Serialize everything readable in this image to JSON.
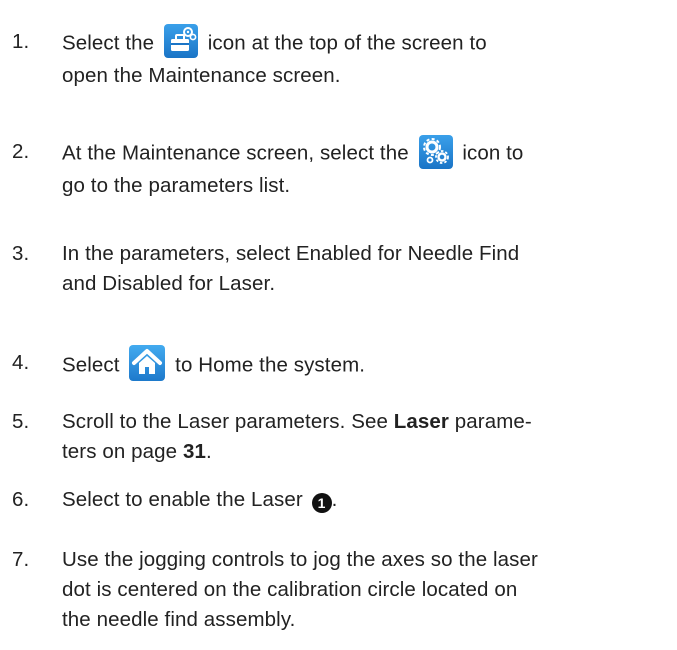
{
  "steps": [
    {
      "num": "1.",
      "text_before": "Select the",
      "icon": "maintenance-toolbox-icon",
      "text_after": "icon at the top of the screen to",
      "line2": "open the Maintenance screen."
    },
    {
      "num": "2.",
      "text_before": "At the Maintenance screen, select the",
      "icon": "gears-icon",
      "text_after": "icon to",
      "line2": "go to the parameters list."
    },
    {
      "num": "3.",
      "line1": "In the parameters, select Enabled for Needle Find",
      "line2": "and Disabled for Laser."
    },
    {
      "num": "4.",
      "text_before": "Select",
      "icon": "home-icon",
      "text_after": "to Home the system."
    },
    {
      "num": "5.",
      "line1_before": "Scroll to the Laser parameters. See",
      "line1_bold": "Laser",
      "line1_after": "parame-",
      "line2_before": "ters on page",
      "line2_bold": "31",
      "line2_after": "."
    },
    {
      "num": "6.",
      "text": "Select to enable the Laser",
      "callout": "1"
    },
    {
      "num": "7.",
      "line1": "Use the jogging controls to jog the axes so the laser",
      "line2": "dot is centered on the calibration circle located on",
      "line3": "the needle find assembly."
    }
  ],
  "colors": {
    "text": "#222222",
    "icon_blue": "#1a74c6",
    "callout_bg": "#111111"
  }
}
